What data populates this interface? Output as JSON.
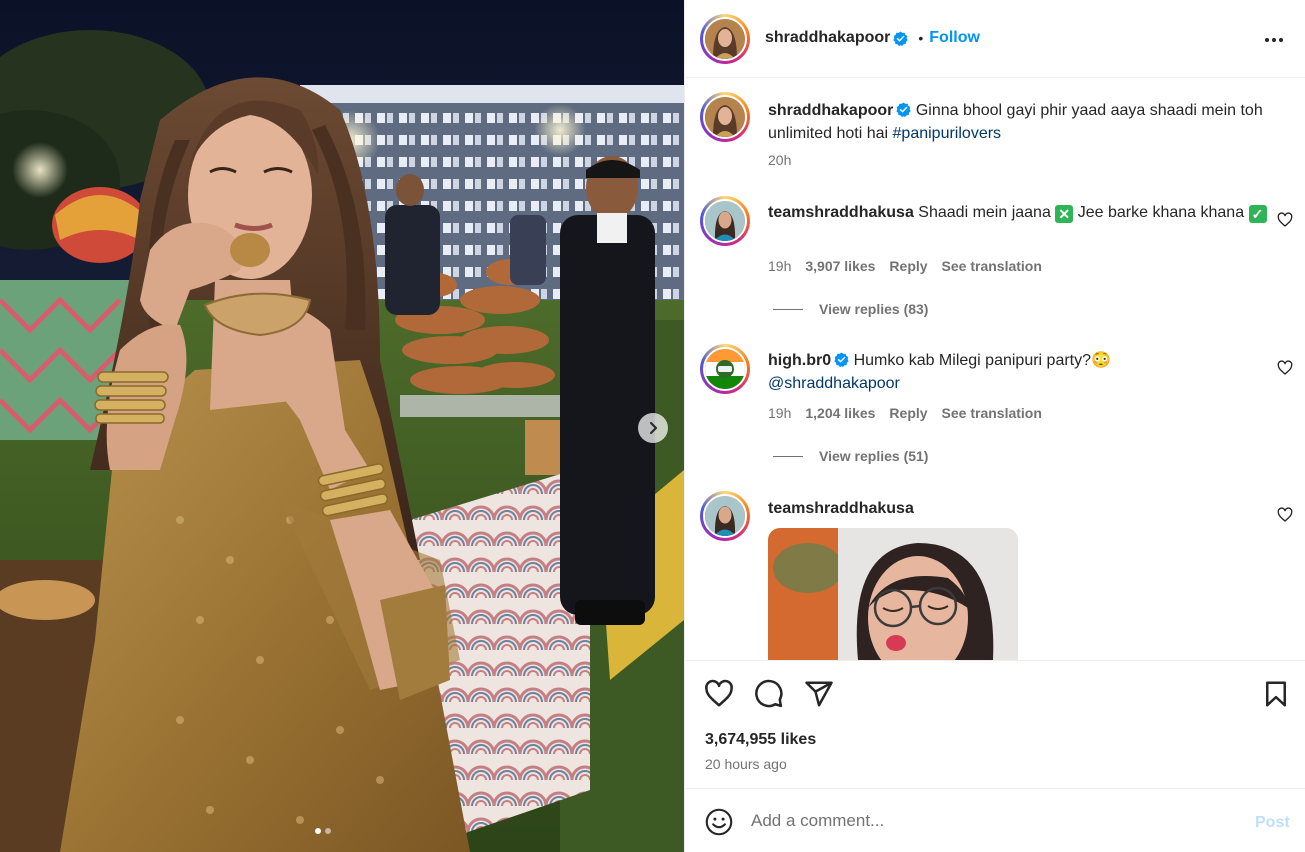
{
  "post": {
    "username": "shraddhakapoor",
    "follow_label": "Follow",
    "separator": "•",
    "more_icon": "more-horizontal-icon",
    "caption": {
      "text": "Ginna bhool gayi phir yaad aaya shaadi mein toh unlimited hoti hai",
      "hashtag": "#panipurilovers",
      "time": "20h"
    },
    "photo": {
      "carousel_total": 2,
      "carousel_active": 1
    }
  },
  "comments": [
    {
      "username": "teamshraddhakusa",
      "text_a": "Shaadi mein jaana",
      "emoji_a": "✕",
      "text_b": "Jee barke khana khana",
      "emoji_b": "✓",
      "time": "19h",
      "likes": "3,907 likes",
      "reply": "Reply",
      "translate": "See translation",
      "view_replies": "View replies (83)"
    },
    {
      "username": "high.br0",
      "text": "Humko kab Milegi panipuri party?",
      "emoji": "😳",
      "mention": "@shraddhakapoor",
      "time": "19h",
      "likes": "1,204 likes",
      "reply": "Reply",
      "translate": "See translation",
      "view_replies": "View replies (51)"
    },
    {
      "username": "teamshraddhakusa"
    }
  ],
  "actions": {
    "likes": "3,674,955 likes",
    "posted": "20 hours ago"
  },
  "composer": {
    "placeholder": "Add a comment...",
    "post_label": "Post"
  },
  "colors": {
    "accent": "#0095f6",
    "verified": "#0095f6",
    "link": "#00376b",
    "post_disabled": "#c0dffd",
    "emoji_green": "#2fb457"
  }
}
